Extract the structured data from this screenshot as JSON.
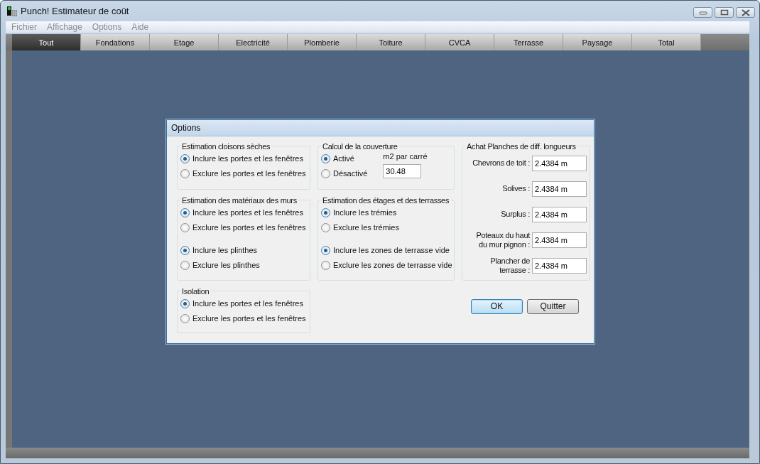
{
  "window": {
    "title": "Punch! Estimateur de coût"
  },
  "menu": [
    "Fichier",
    "Affichage",
    "Options",
    "Aide"
  ],
  "tabs": [
    {
      "label": "Tout",
      "selected": true
    },
    {
      "label": "Fondations",
      "selected": false
    },
    {
      "label": "Etage",
      "selected": false
    },
    {
      "label": "Electricité",
      "selected": false
    },
    {
      "label": "Plomberie",
      "selected": false
    },
    {
      "label": "Toiture",
      "selected": false
    },
    {
      "label": "CVCA",
      "selected": false
    },
    {
      "label": "Terrasse",
      "selected": false
    },
    {
      "label": "Paysage",
      "selected": false
    },
    {
      "label": "Total",
      "selected": false
    }
  ],
  "dialog": {
    "title": "Options",
    "groups": [
      {
        "kind": "radio",
        "title": "Estimation cloisons sèches",
        "sets": [
          [
            {
              "label": "Inclure les portes et les fenêtres",
              "selected": true
            },
            {
              "label": "Exclure les portes et les fenêtres",
              "selected": false
            }
          ]
        ]
      },
      {
        "kind": "radio_field",
        "title": "Calcul de la couverture",
        "field_label": "m2 par carré",
        "field_value": "30.48",
        "sets": [
          [
            {
              "label": "Activé",
              "selected": true
            },
            {
              "label": "Désactivé",
              "selected": false
            }
          ]
        ]
      },
      {
        "kind": "radio",
        "title": "Estimation des matériaux des murs",
        "sets": [
          [
            {
              "label": "Inclure les portes et les fenêtres",
              "selected": true
            },
            {
              "label": "Exclure les portes et les fenêtres",
              "selected": false
            }
          ],
          [
            {
              "label": "Inclure les plinthes",
              "selected": true
            },
            {
              "label": "Exclure les plinthes",
              "selected": false
            }
          ]
        ]
      },
      {
        "kind": "radio",
        "title": "Estimation des étages et des terrasses",
        "sets": [
          [
            {
              "label": "Inclure les trémies",
              "selected": true
            },
            {
              "label": "Exclure les trémies",
              "selected": false
            }
          ],
          [
            {
              "label": "Inclure les zones de terrasse vide",
              "selected": true
            },
            {
              "label": "Exclure les zones de terrasse vide",
              "selected": false
            }
          ]
        ]
      },
      {
        "kind": "fields",
        "title": "Achat Planches de diff. longueurs",
        "fields": [
          {
            "label": "Chevrons de toit :",
            "value": "2.4384 m"
          },
          {
            "label": "Solives :",
            "value": "2.4384 m"
          },
          {
            "label": "Surplus :",
            "value": "2.4384 m"
          },
          {
            "label": "Poteaux du haut du mur pignon :",
            "value": "2.4384 m"
          },
          {
            "label": "Plancher de terrasse :",
            "value": "2.4384 m"
          }
        ]
      },
      {
        "kind": "radio",
        "title": "Isolation",
        "sets": [
          [
            {
              "label": "Inclure les portes et les fenêtres",
              "selected": true
            },
            {
              "label": "Exclure les portes et les fenêtres",
              "selected": false
            }
          ]
        ]
      }
    ],
    "buttons": [
      {
        "label": "OK",
        "default": true
      },
      {
        "label": "Quitter",
        "default": false
      }
    ]
  }
}
